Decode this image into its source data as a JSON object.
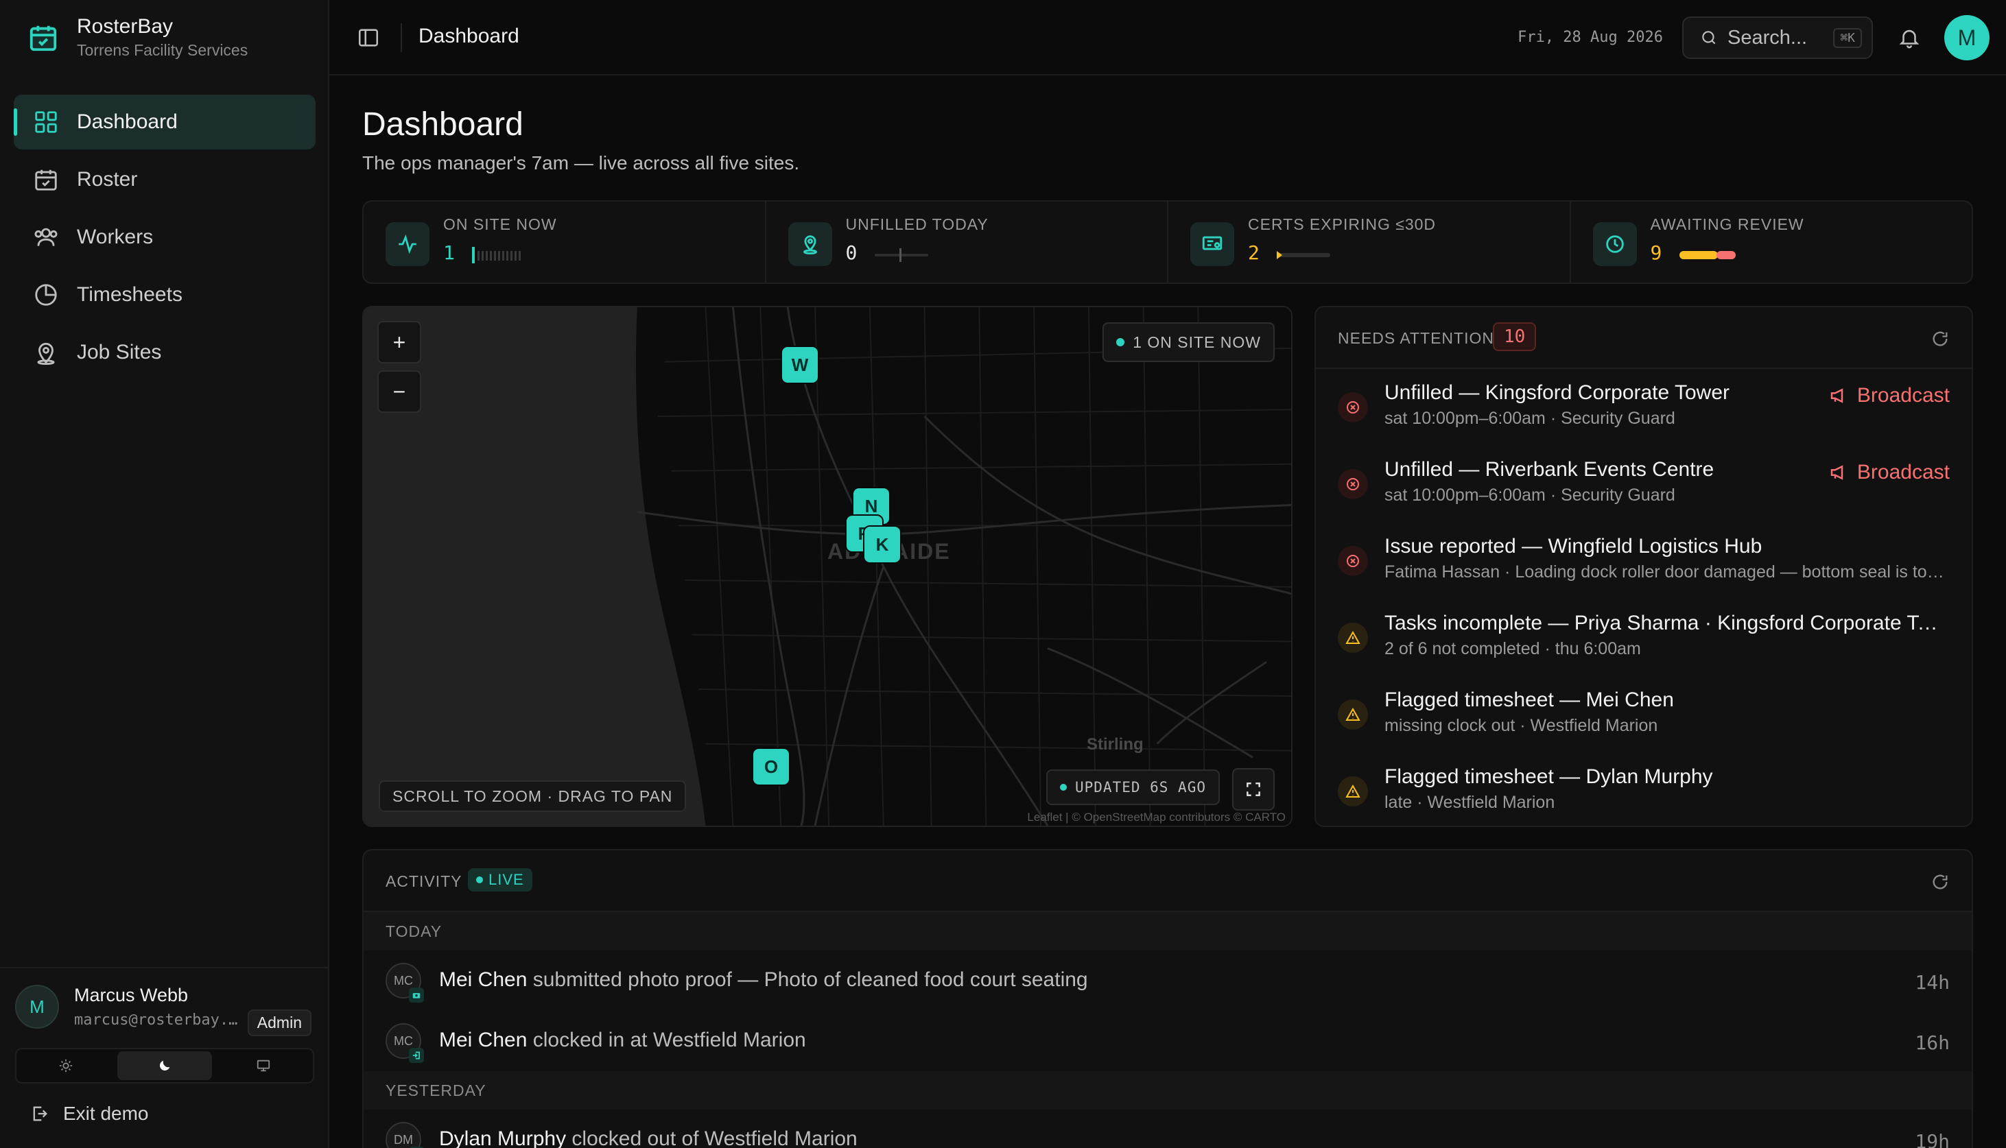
{
  "brand": {
    "name": "RosterBay",
    "org": "Torrens Facility Services"
  },
  "nav": [
    {
      "label": "Dashboard",
      "icon": "grid-icon",
      "active": true
    },
    {
      "label": "Roster",
      "icon": "calendar-icon"
    },
    {
      "label": "Workers",
      "icon": "users-icon"
    },
    {
      "label": "Timesheets",
      "icon": "clock-icon"
    },
    {
      "label": "Job Sites",
      "icon": "map-pin-icon"
    }
  ],
  "user": {
    "initial": "M",
    "name": "Marcus Webb",
    "email": "marcus@rosterbay.…",
    "role": "Admin"
  },
  "exit_label": "Exit demo",
  "header": {
    "title": "Dashboard",
    "date": "Fri, 28 Aug 2026",
    "search_placeholder": "Search...",
    "search_shortcut": "⌘K",
    "avatar": "M"
  },
  "page": {
    "title": "Dashboard",
    "subtitle": "The ops manager's 7am — live across all five sites."
  },
  "stats": [
    {
      "label": "ON SITE NOW",
      "value": "1",
      "color": "#2dd4bf"
    },
    {
      "label": "UNFILLED TODAY",
      "value": "0",
      "color": "#e8e8e8"
    },
    {
      "label": "CERTS EXPIRING ≤30D",
      "value": "2",
      "color": "#fbbf24"
    },
    {
      "label": "AWAITING REVIEW",
      "value": "9",
      "color": "#fbbf24"
    }
  ],
  "map": {
    "on_site_label": "1 ON SITE NOW",
    "hint": "SCROLL TO ZOOM · DRAG TO PAN",
    "updated": "UPDATED 6S AGO",
    "attribution": "Leaflet | © OpenStreetMap contributors © CARTO",
    "city_label": "ADELAIDE",
    "suburb_label": "Stirling",
    "zoom_in": "+",
    "zoom_out": "−",
    "pins": [
      "W",
      "N",
      "R",
      "K",
      "O"
    ]
  },
  "attention": {
    "title": "NEEDS ATTENTION",
    "count": "10",
    "items": [
      {
        "severity": "red",
        "title": "Unfilled — Kingsford Corporate Tower",
        "sub": "sat 10:00pm–6:00am · Security Guard",
        "action": "Broadcast"
      },
      {
        "severity": "red",
        "title": "Unfilled — Riverbank Events Centre",
        "sub": "sat 10:00pm–6:00am · Security Guard",
        "action": "Broadcast"
      },
      {
        "severity": "red",
        "title": "Issue reported — Wingfield Logistics Hub",
        "sub": "Fatima Hassan · Loading dock roller door damaged — bottom seal is torn and the door doesn't close fully",
        "action": ""
      },
      {
        "severity": "amber",
        "title": "Tasks incomplete — Priya Sharma · Kingsford Corporate Tower",
        "sub": "2 of 6 not completed · thu 6:00am",
        "action": ""
      },
      {
        "severity": "amber",
        "title": "Flagged timesheet — Mei Chen",
        "sub": "missing clock out · Westfield Marion",
        "action": ""
      },
      {
        "severity": "amber",
        "title": "Flagged timesheet — Dylan Murphy",
        "sub": "late · Westfield Marion",
        "action": ""
      }
    ]
  },
  "activity": {
    "title": "ACTIVITY",
    "live": "LIVE",
    "groups": [
      {
        "day": "TODAY",
        "rows": [
          {
            "initials": "MC",
            "name": "Mei Chen",
            "text": "submitted photo proof — Photo of cleaned food court seating",
            "time": "14h",
            "badge": "camera-icon"
          },
          {
            "initials": "MC",
            "name": "Mei Chen",
            "text": "clocked in at Westfield Marion",
            "time": "16h",
            "badge": "login-icon"
          }
        ]
      },
      {
        "day": "YESTERDAY",
        "rows": [
          {
            "initials": "DM",
            "name": "Dylan Murphy",
            "text": "clocked out of Westfield Marion",
            "time": "19h",
            "badge": "logout-icon"
          }
        ]
      }
    ]
  }
}
